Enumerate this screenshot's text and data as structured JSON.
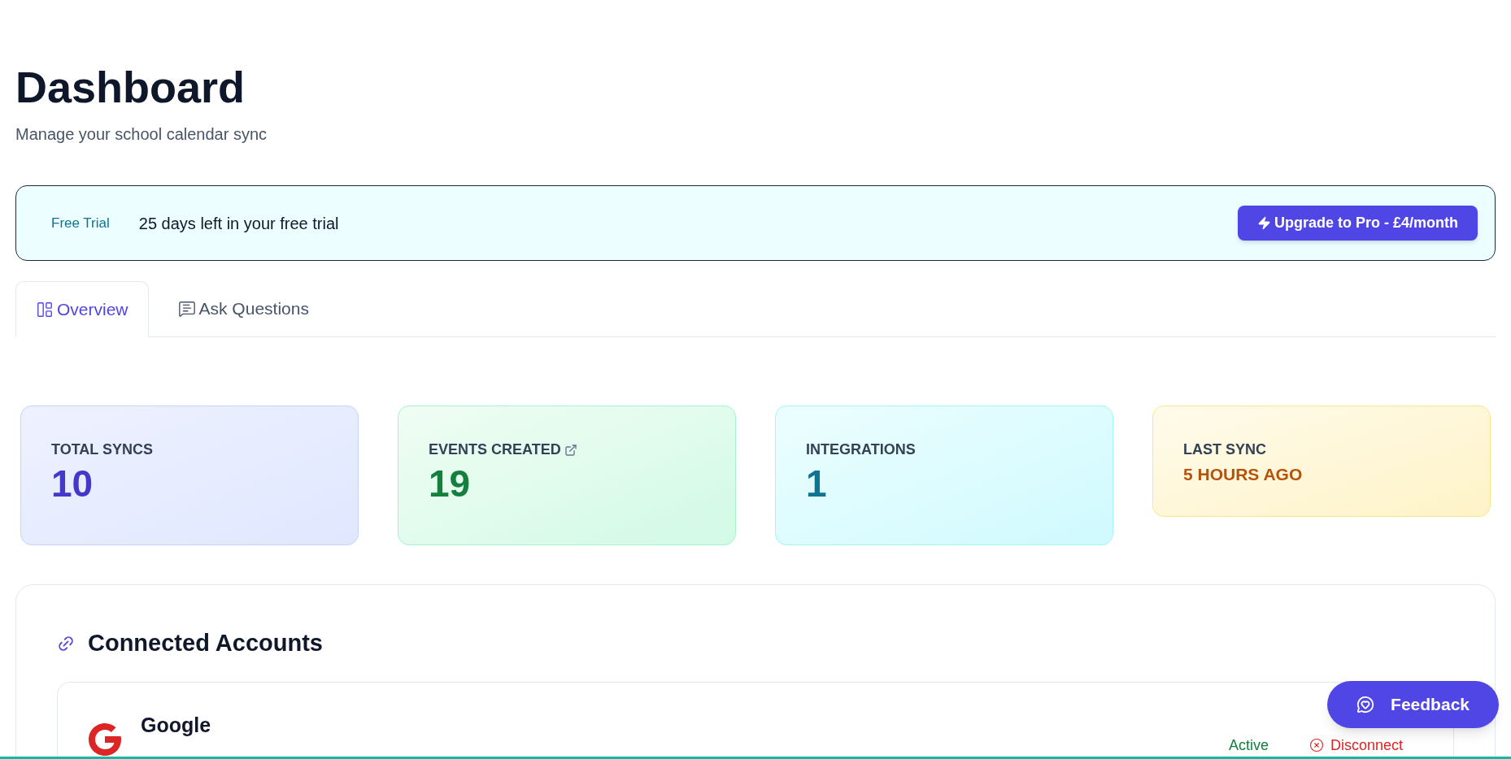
{
  "header": {
    "title": "Dashboard",
    "subtitle": "Manage your school calendar sync"
  },
  "trial_banner": {
    "badge": "Free Trial",
    "message": "25 days left in your free trial",
    "upgrade_button": "Upgrade to Pro - £4/month"
  },
  "tabs": [
    {
      "label": "Overview",
      "kind": "overview",
      "selected": true
    },
    {
      "label": "Ask Questions",
      "kind": "chat",
      "selected": false
    }
  ],
  "stats": [
    {
      "label": "TOTAL SYNCS",
      "value": "10",
      "kind": "indigo",
      "link": false
    },
    {
      "label": "EVENTS CREATED",
      "value": "19",
      "kind": "green",
      "link": true
    },
    {
      "label": "INTEGRATIONS",
      "value": "1",
      "kind": "cyan",
      "link": false
    },
    {
      "label": "LAST SYNC",
      "value": "5 HOURS AGO",
      "kind": "amber",
      "link": false
    }
  ],
  "connected_accounts": {
    "title": "Connected Accounts",
    "accounts": [
      {
        "name": "Google",
        "status": "Active",
        "action": "Disconnect"
      }
    ]
  },
  "feedback_button": "Feedback"
}
